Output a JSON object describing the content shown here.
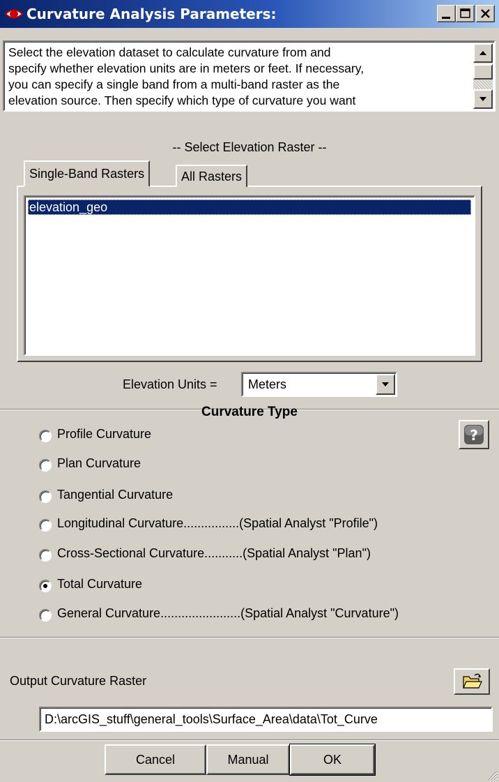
{
  "window": {
    "title": "Curvature Analysis Parameters:",
    "minimize": "minimize-icon",
    "maximize": "maximize-icon",
    "close": "close-icon"
  },
  "description": {
    "text": "Select the elevation dataset to calculate curvature from and\nspecify whether elevation units are in meters or feet. If necessary,\nyou can specify a single band from a multi-band raster as the\nelevation source. Then specify which type of curvature you want"
  },
  "raster": {
    "caption": "-- Select Elevation Raster --",
    "tabs": [
      {
        "label": "Single-Band Rasters",
        "selected": true
      },
      {
        "label": "All Rasters",
        "selected": false
      }
    ],
    "items": [
      {
        "label": "elevation_geo",
        "selected": true
      }
    ]
  },
  "elevation_units": {
    "label": "Elevation Units =",
    "value": "Meters"
  },
  "curvature_type": {
    "title": "Curvature Type",
    "options": [
      {
        "label": "Profile Curvature",
        "checked": false
      },
      {
        "label": "Plan Curvature",
        "checked": false
      },
      {
        "label": "Tangential Curvature",
        "checked": false
      },
      {
        "label": "Longitudinal Curvature................(Spatial Analyst \"Profile\")",
        "checked": false
      },
      {
        "label": "Cross-Sectional Curvature...........(Spatial Analyst \"Plan\")",
        "checked": false
      },
      {
        "label": "Total Curvature",
        "checked": true
      },
      {
        "label": "General Curvature.......................(Spatial Analyst \"Curvature\")",
        "checked": false
      }
    ]
  },
  "output": {
    "label": "Output Curvature Raster",
    "path": "D:\\arcGIS_stuff\\general_tools\\Surface_Area\\data\\Tot_Curve"
  },
  "buttons": {
    "cancel": "Cancel",
    "manual": "Manual",
    "ok": "OK"
  },
  "colors": {
    "title_gradient_start": "#0a246a",
    "title_gradient_end": "#a6caf0",
    "face": "#d4d0c8",
    "selection": "#0a246a"
  }
}
